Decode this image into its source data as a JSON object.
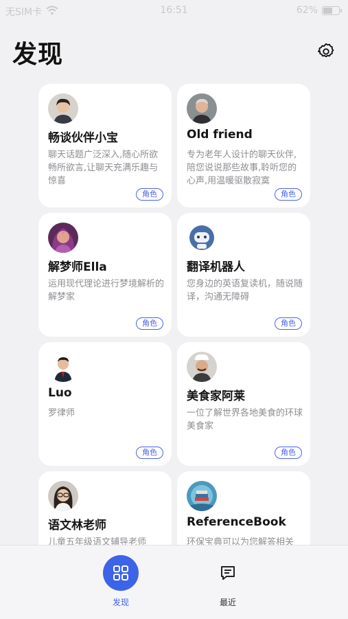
{
  "status_bar": {
    "carrier": "无SIM卡",
    "time": "16:51",
    "battery": "62%",
    "battery_level": 0.62
  },
  "header": {
    "title": "发现"
  },
  "cards": [
    {
      "name": "畅谈伙伴小宝",
      "desc": "聊天话题广泛深入,随心所欲畅所欲言,让聊天充满乐趣与惊喜",
      "badge": "角色"
    },
    {
      "name": "Old friend",
      "desc": "专为老年人设计的聊天伙伴,陪您说说那些故事,聆听您的心声,用温暖驱散寂寞",
      "badge": "角色"
    },
    {
      "name": "解梦师Ella",
      "desc": "运用现代理论进行梦境解析的解梦家",
      "badge": "角色"
    },
    {
      "name": "翻译机器人",
      "desc": "您身边的英语复读机，随说随译，沟通无障碍",
      "badge": "角色"
    },
    {
      "name": "Luo",
      "desc": "罗律师",
      "badge": "角色"
    },
    {
      "name": "美食家阿莱",
      "desc": "一位了解世界各地美食的环球美食家",
      "badge": "角色"
    },
    {
      "name": "语文林老师",
      "desc": "儿童五年级语文辅导老师",
      "badge": ""
    },
    {
      "name": "ReferenceBook",
      "desc": "环保宝典可以为您解答相关",
      "badge": ""
    }
  ],
  "tabs": [
    {
      "label": "发现",
      "icon": "grid-icon",
      "active": true
    },
    {
      "label": "最近",
      "icon": "chat-icon",
      "active": false
    }
  ],
  "colors": {
    "accent": "#3d63e6",
    "background": "#f1f1f3",
    "card": "#ffffff"
  }
}
